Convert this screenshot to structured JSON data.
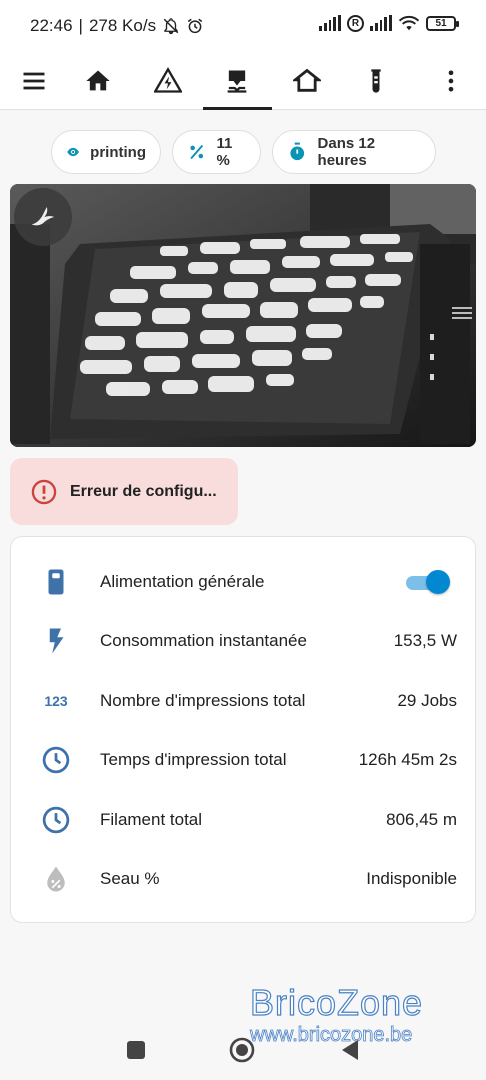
{
  "status_bar": {
    "time": "22:46",
    "separator": "|",
    "speed": "278 Ko/s",
    "battery": "51",
    "icons": [
      "notifications-off-icon",
      "alarm-icon",
      "signal-icon",
      "roaming-icon",
      "signal-icon",
      "wifi-icon",
      "battery-icon"
    ]
  },
  "toolbar": {
    "items": [
      "menu-icon",
      "home-icon",
      "energy-icon",
      "printer-icon",
      "home-outline-icon",
      "test-tube-icon",
      "more-vert-icon"
    ],
    "active_index": 3
  },
  "chips": [
    {
      "icon": "eye-icon",
      "label": "printing"
    },
    {
      "icon": "percent-icon",
      "label": "11 %"
    },
    {
      "icon": "timer-icon",
      "label": "Dans 12 heures"
    }
  ],
  "camera": {
    "logo_icon": "bird-icon",
    "menu_icon": "menu-icon"
  },
  "error": {
    "icon": "alert-circle-icon",
    "text": "Erreur de configu..."
  },
  "entities": [
    {
      "icon": "power-switch-icon",
      "label": "Alimentation générale",
      "value": "",
      "toggle_on": true
    },
    {
      "icon": "flash-icon",
      "label": "Consommation instantanée",
      "value": "153,5 W"
    },
    {
      "icon": "numeric-icon",
      "label": "Nombre d'impressions total",
      "value": "29 Jobs"
    },
    {
      "icon": "clock-icon",
      "label": "Temps d'impression total",
      "value": "126h 45m 2s"
    },
    {
      "icon": "clock-icon",
      "label": "Filament total",
      "value": "806,45 m"
    },
    {
      "icon": "water-percent-icon",
      "label": "Seau %",
      "value": "Indisponible"
    }
  ],
  "watermark": {
    "title": "BricoZone",
    "url": "www.bricozone.be"
  },
  "navbar": [
    "recents-icon",
    "home-button-icon",
    "back-icon"
  ],
  "colors": {
    "accent": "#3f72a8",
    "teal": "#0a94b4",
    "error_bg": "#f9dcdc",
    "error_icon": "#c8453e",
    "toggle": "#0288d1"
  }
}
